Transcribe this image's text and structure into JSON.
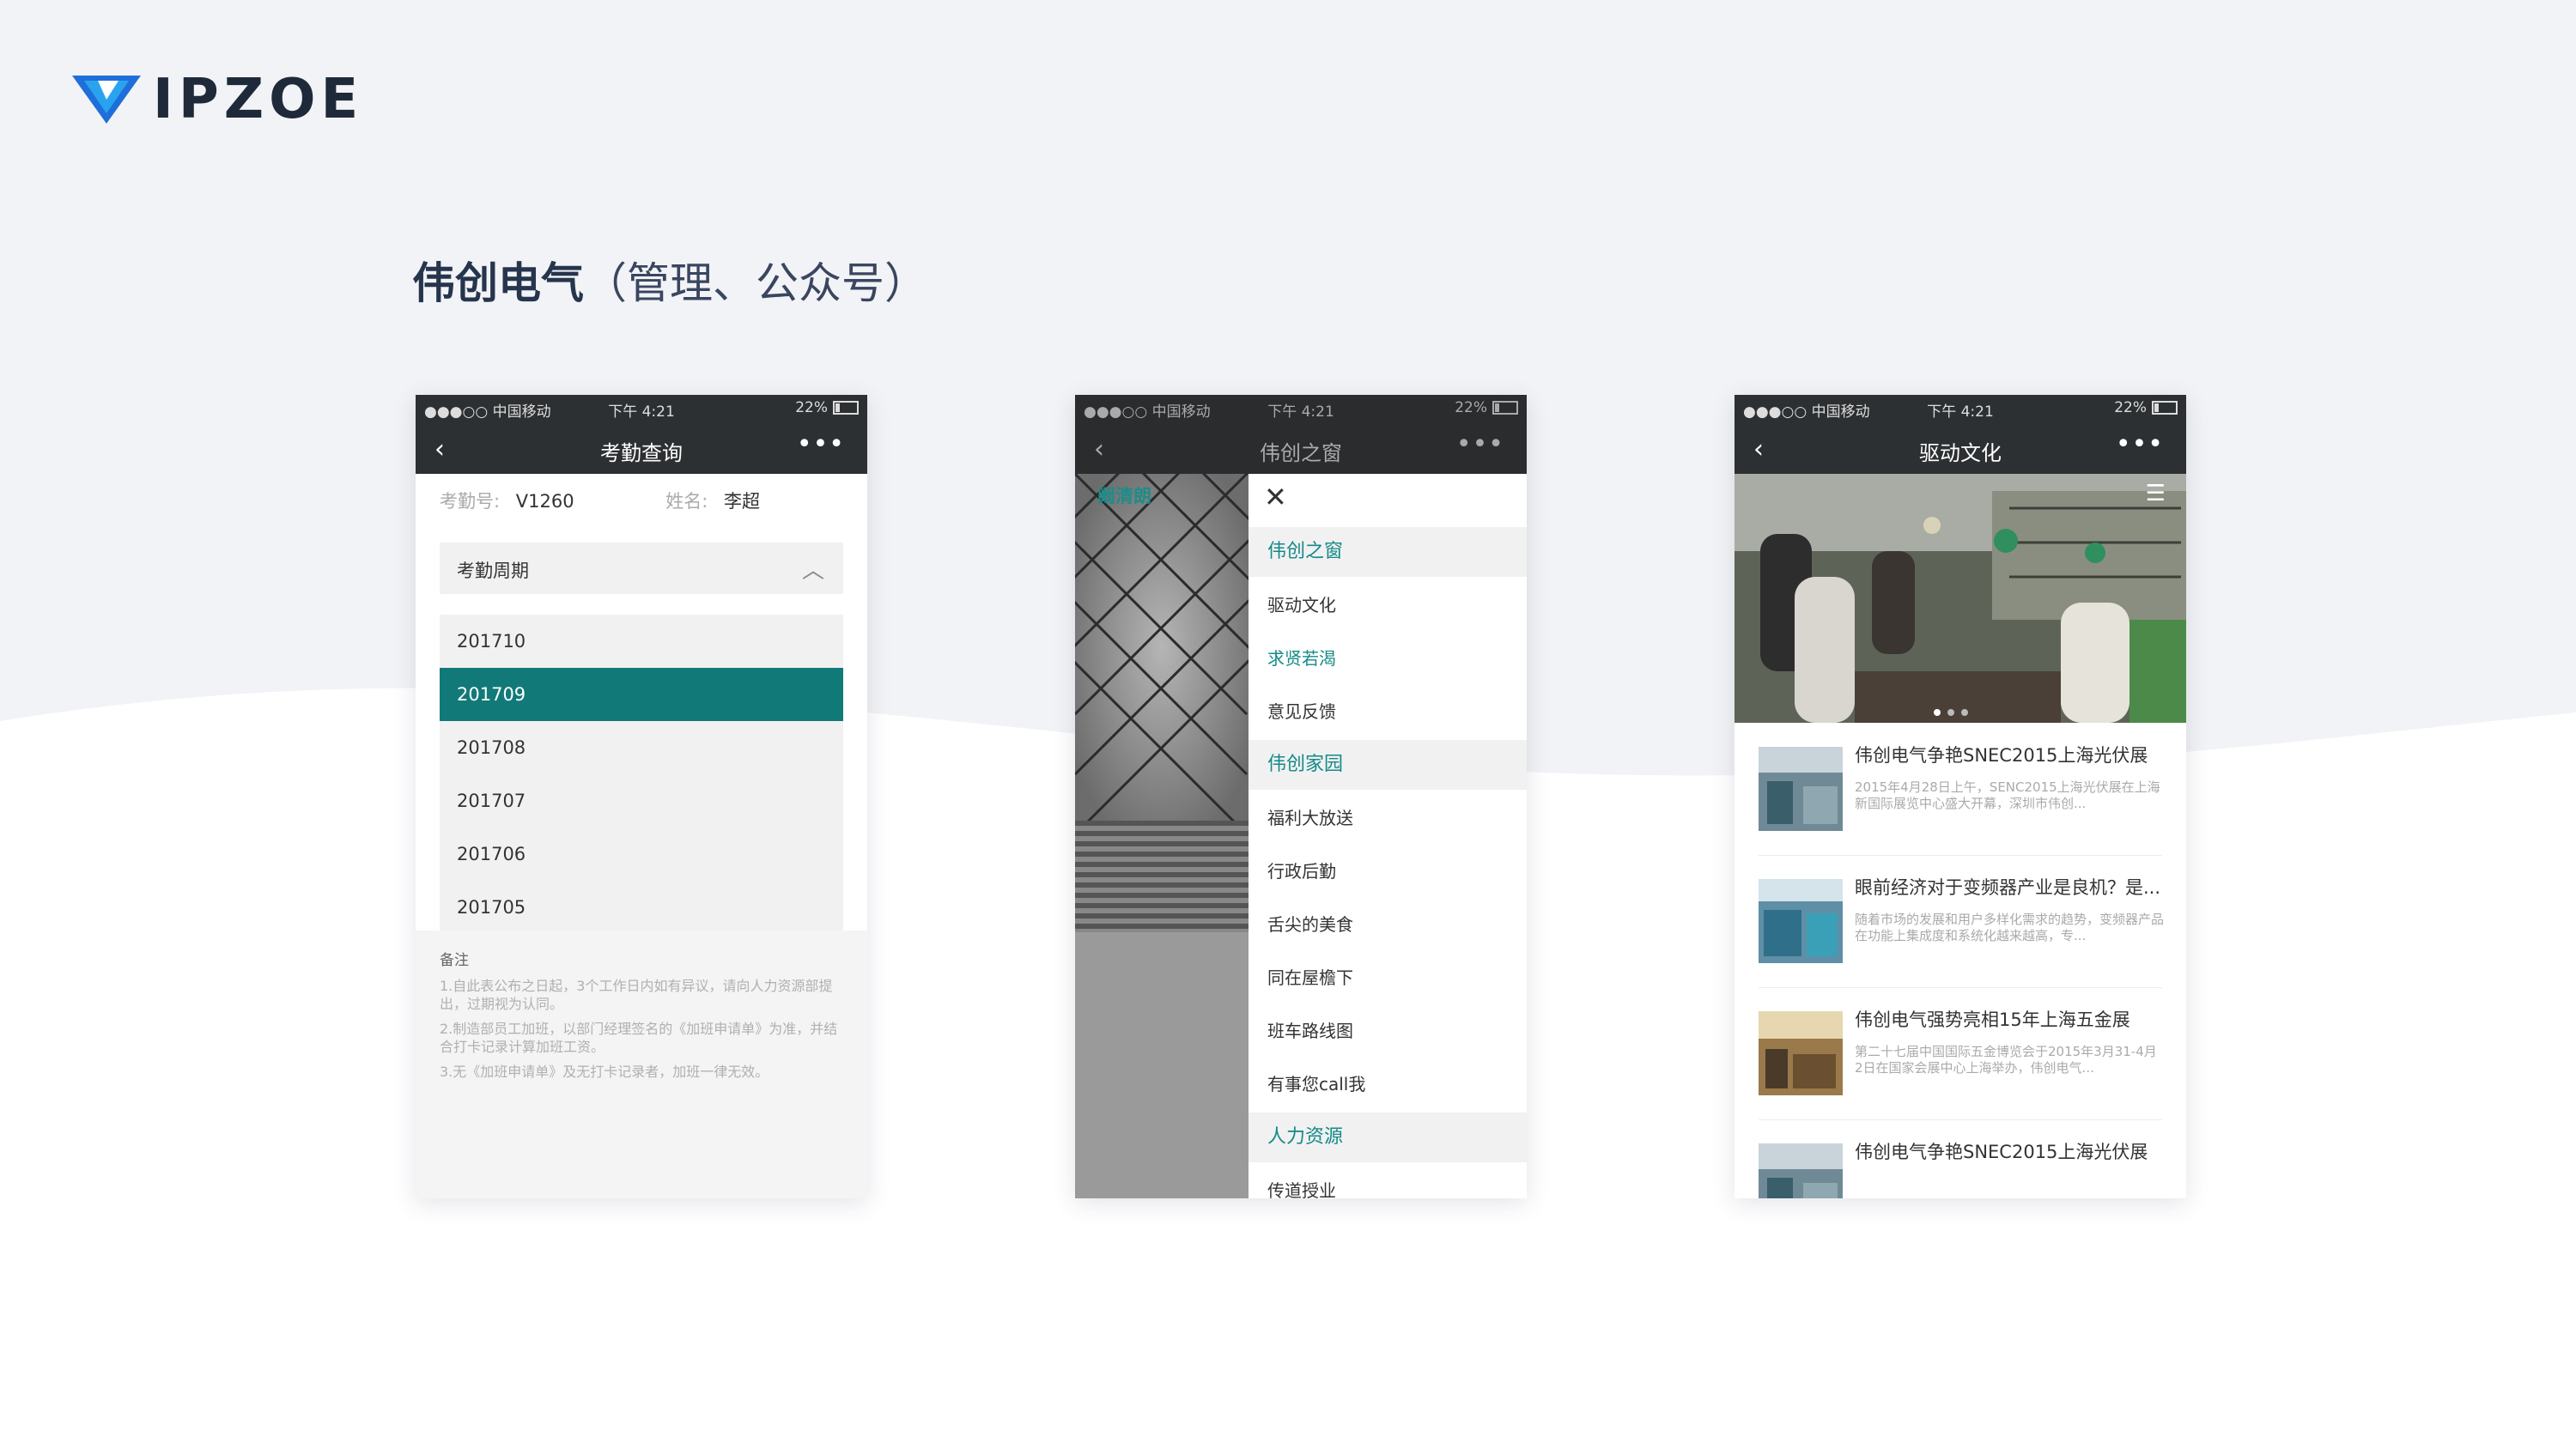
{
  "brand": {
    "logo_text": "IPZOE",
    "accent": "#1e88e5"
  },
  "page": {
    "title_main": "伟创电气",
    "title_sub": "（管理、公众号）"
  },
  "status_bar": {
    "carrier": "●●●○○ 中国移动",
    "time": "下午 4:21",
    "battery": "22%"
  },
  "phone1": {
    "nav_title": "考勤查询",
    "id_label": "考勤号:",
    "id_value": "V1260",
    "name_label": "姓名:",
    "name_value": "李超",
    "period_label": "考勤周期",
    "periods": [
      "201710",
      "201709",
      "201708",
      "201707",
      "201706",
      "201705"
    ],
    "selected_period": "201709",
    "notes_heading": "备注",
    "notes": [
      "1.自此表公布之日起，3个工作日内如有异议，请向人力资源部提出，过期视为认同。",
      "2.制造部员工加班，以部门经理签名的《加班申请单》为准，并结合打卡记录计算加班工资。",
      "3.无《加班申请单》及无打卡记录者，加班一律无效。"
    ]
  },
  "phone2": {
    "nav_title": "伟创之窗",
    "user_name": "阚清朗",
    "menu": [
      {
        "label": "伟创之窗",
        "type": "section"
      },
      {
        "label": "驱动文化",
        "type": "item"
      },
      {
        "label": "求贤若渴",
        "type": "highlight"
      },
      {
        "label": "意见反馈",
        "type": "item"
      },
      {
        "label": "伟创家园",
        "type": "section"
      },
      {
        "label": "福利大放送",
        "type": "item"
      },
      {
        "label": "行政后勤",
        "type": "item"
      },
      {
        "label": "舌尖的美食",
        "type": "item"
      },
      {
        "label": "同在屋檐下",
        "type": "item"
      },
      {
        "label": "班车路线图",
        "type": "item"
      },
      {
        "label": "有事您call我",
        "type": "item"
      },
      {
        "label": "人力资源",
        "type": "section"
      },
      {
        "label": "传道授业",
        "type": "item"
      }
    ]
  },
  "phone3": {
    "nav_title": "驱动文化",
    "news": [
      {
        "title": "伟创电气争艳SNEC2015上海光伏展",
        "desc": "2015年4月28日上午，SENC2015上海光伏展在上海新国际展览中心盛大开幕，深圳市伟创..."
      },
      {
        "title": "眼前经济对于变频器产业是良机？是...",
        "desc": "随着市场的发展和用户多样化需求的趋势，变频器产品在功能上集成度和系统化越来越高，专..."
      },
      {
        "title": "伟创电气强势亮相15年上海五金展",
        "desc": "第二十七届中国国际五金博览会于2015年3月31-4月2日在国家会展中心上海举办，伟创电气..."
      },
      {
        "title": "伟创电气争艳SNEC2015上海光伏展",
        "desc": ""
      }
    ]
  }
}
